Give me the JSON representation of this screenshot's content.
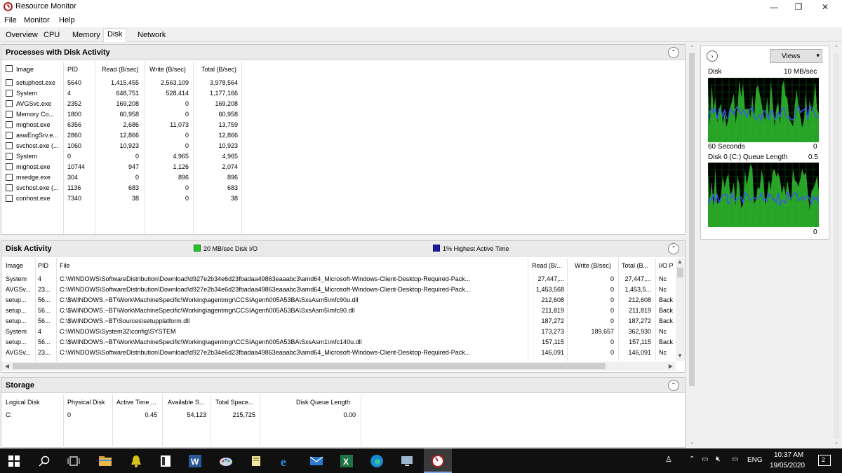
{
  "window": {
    "title": "Resource Monitor",
    "controls": {
      "minimize": "—",
      "maximize": "❐",
      "close": "✕"
    }
  },
  "menu": [
    "File",
    "Monitor",
    "Help"
  ],
  "tabs": [
    "Overview",
    "CPU",
    "Memory",
    "Disk",
    "Network"
  ],
  "active_tab": "Disk",
  "processes": {
    "title": "Processes with Disk Activity",
    "columns": [
      "Image",
      "PID",
      "Read (B/sec)",
      "Write (B/sec)",
      "Total (B/sec)"
    ],
    "rows": [
      [
        "setuphost.exe",
        "5640",
        "1,415,455",
        "2,563,109",
        "3,978,564"
      ],
      [
        "System",
        "4",
        "648,751",
        "528,414",
        "1,177,166"
      ],
      [
        "AVGSvc.exe",
        "2352",
        "169,208",
        "0",
        "169,208"
      ],
      [
        "Memory Co...",
        "1800",
        "60,958",
        "0",
        "60,958"
      ],
      [
        "mighost.exe",
        "6356",
        "2,686",
        "11,073",
        "13,759"
      ],
      [
        "aswEngSrv.e...",
        "2860",
        "12,866",
        "0",
        "12,866"
      ],
      [
        "svchost.exe (...",
        "1060",
        "10,923",
        "0",
        "10,923"
      ],
      [
        "System",
        "0",
        "0",
        "4,965",
        "4,965"
      ],
      [
        "mighost.exe",
        "10744",
        "947",
        "1,126",
        "2,074"
      ],
      [
        "msedge.exe",
        "304",
        "0",
        "896",
        "896"
      ],
      [
        "svchost.exe (...",
        "1136",
        "683",
        "0",
        "683"
      ],
      [
        "conhost.exe",
        "7340",
        "38",
        "0",
        "38"
      ]
    ]
  },
  "disk_activity": {
    "title": "Disk Activity",
    "legend_io": "20 MB/sec Disk I/O",
    "legend_active": "1% Highest Active Time",
    "colors": {
      "io": "#22c322",
      "active": "#1a1aa8"
    },
    "columns": [
      "Image",
      "PID",
      "File",
      "Read (B/...",
      "Write (B/sec)",
      "Total (B...",
      "I/O P"
    ],
    "rows": [
      [
        "System",
        "4",
        "C:\\WINDOWS\\SoftwareDistribution\\Download\\d927e2b34e6d23fbadaa49863eaaabc3\\amd64_Microsoft-Windows-Client-Desktop-Required-Pack...",
        "27,447,...",
        "0",
        "27,447,...",
        "Nc"
      ],
      [
        "AVGSv...",
        "23...",
        "C:\\WINDOWS\\SoftwareDistribution\\Download\\d927e2b34e6d23fbadaa49863eaaabc3\\amd64_Microsoft-Windows-Client-Desktop-Required-Pack...",
        "1,453,568",
        "0",
        "1,453,5...",
        "Nc"
      ],
      [
        "setup...",
        "56...",
        "C:\\$WINDOWS.~BT\\Work\\MachineSpecific\\Working\\agentmgr\\CCSIAgent\\005A53BA\\SxsAsm5\\mfc90u.dll",
        "212,608",
        "0",
        "212,608",
        "Back"
      ],
      [
        "setup...",
        "56...",
        "C:\\$WINDOWS.~BT\\Work\\MachineSpecific\\Working\\agentmgr\\CCSIAgent\\005A53BA\\SxsAsm5\\mfc90.dll",
        "211,819",
        "0",
        "211,819",
        "Back"
      ],
      [
        "setup...",
        "56...",
        "C:\\$WINDOWS.~BT\\Sources\\setupplatform.dll",
        "187,272",
        "0",
        "187,272",
        "Back"
      ],
      [
        "System",
        "4",
        "C:\\WINDOWS\\System32\\config\\SYSTEM",
        "173,273",
        "189,657",
        "362,930",
        "Nc"
      ],
      [
        "setup...",
        "56...",
        "C:\\$WINDOWS.~BT\\Work\\MachineSpecific\\Working\\agentmgr\\CCSIAgent\\005A53BA\\SxsAsm1\\mfc140u.dll",
        "157,115",
        "0",
        "157,115",
        "Back"
      ],
      [
        "AVGSv...",
        "23...",
        "C:\\WINDOWS\\SoftwareDistribution\\Download\\d927e2b34e6d23fbadaa49863eaaabc3\\amd64_Microsoft-Windows-Client-Desktop-Required-Pack...",
        "146,091",
        "0",
        "146,091",
        "Nc"
      ]
    ]
  },
  "storage": {
    "title": "Storage",
    "columns": [
      "Logical Disk",
      "Physical Disk",
      "Active Time ...",
      "Available S...",
      "Total Space...",
      "Disk Queue Length"
    ],
    "rows": [
      [
        "C:",
        "0",
        "0.45",
        "54,123",
        "215,725",
        "0.00"
      ]
    ]
  },
  "graphs": {
    "views_label": "Views",
    "disk": {
      "label": "Disk",
      "scale": "10 MB/sec",
      "x_label": "60 Seconds",
      "min": "0"
    },
    "queue": {
      "label": "Disk 0 (C:) Queue Length",
      "scale": "0.5",
      "min": "0"
    }
  },
  "taskbar": {
    "lang": "ENG",
    "time": "10:37 AM",
    "date": "19/05/2020",
    "notification_badge": "2"
  }
}
